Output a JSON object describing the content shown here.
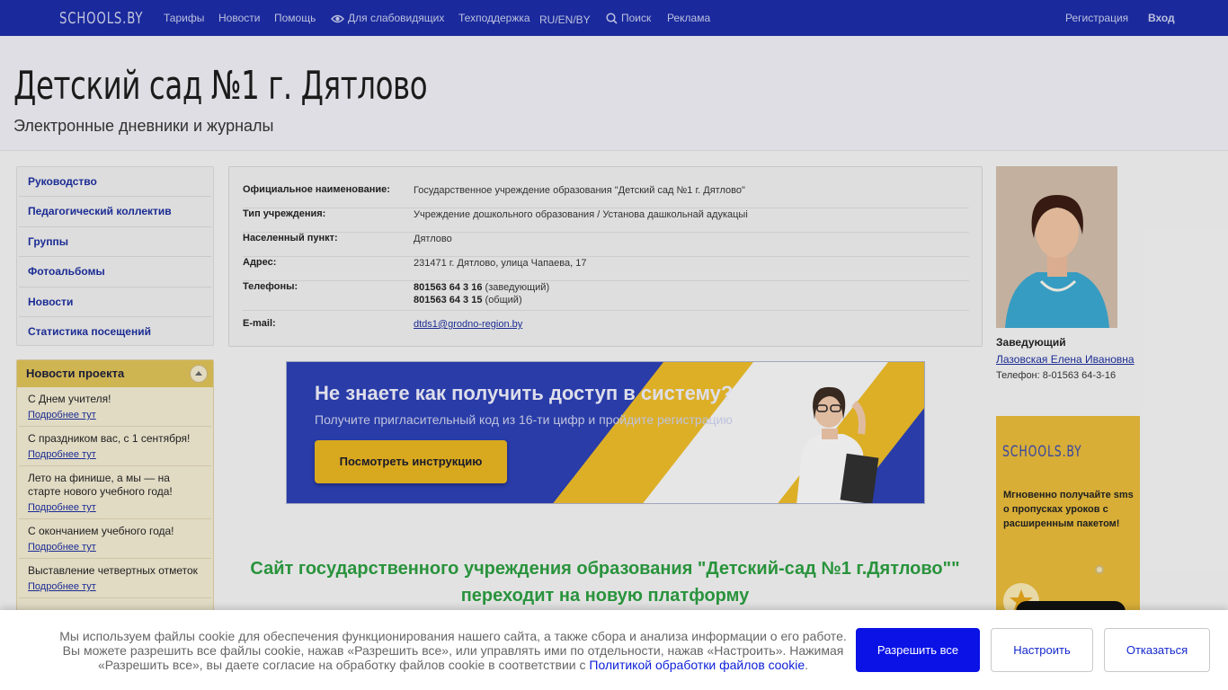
{
  "topbar": {
    "logo": "SCHOOLS.BY",
    "nav": [
      "Тарифы",
      "Новости",
      "Помощь",
      "Для слабовидящих",
      "Техподдержка",
      "RU/EN/BY",
      "Поиск",
      "Реклама"
    ],
    "register": "Регистрация",
    "login": "Вход"
  },
  "header": {
    "title": "Детский сад №1 г. Дятлово",
    "subtitle": "Электронные дневники и журналы"
  },
  "sidebar": {
    "items": [
      "Руководство",
      "Педагогический коллектив",
      "Группы",
      "Фотоальбомы",
      "Новости",
      "Статистика посещений"
    ]
  },
  "project_news": {
    "title": "Новости проекта",
    "more": "Подробнее тут",
    "items": [
      "С Днем учителя!",
      "С праздником вас, с 1 сентября!",
      "Лето на финише, а мы — на старте нового учебного года!",
      "С окончанием учебного года!",
      "Выставление четвертных отметок"
    ]
  },
  "info": {
    "rows": [
      {
        "label": "Официальное наименование:",
        "value": "Государственное учреждение образования \"Детский сад №1 г. Дятлово\""
      },
      {
        "label": "Тип учреждения:",
        "value": "Учреждение дошкольного образования / Установа дашкольнай адукацыі"
      },
      {
        "label": "Населенный пункт:",
        "value": "Дятлово"
      },
      {
        "label": "Адрес:",
        "value": "231471 г. Дятлово, улица Чапаева, 17"
      }
    ],
    "phones_label": "Телефоны:",
    "phone1": "801563 64 3 16",
    "phone1_note": " (заведующий)",
    "phone2": "801563 64 3 15",
    "phone2_note": " (общий)",
    "email_label": "E-mail:",
    "email": "dtds1@grodno-region.by"
  },
  "banner": {
    "headline": "Не знаете как получить доступ в систему?",
    "subline": "Получите пригласительный код из 16-ти цифр и пройдите регистрацию",
    "button": "Посмотреть инструкцию"
  },
  "notice": "Сайт государственного учреждения образования \"Детский-сад №1 г.Дятлово\"\" переходит на новую платформу",
  "director": {
    "role": "Заведующий",
    "name": "Лазовская Елена Ивановна",
    "phone": "Телефон: 8-01563 64-3-16"
  },
  "side_ad": {
    "logo": "SCHOOLS.BY",
    "text": "Мгновенно получайте sms о пропусках уроков с расширенным пакетом!"
  },
  "cookie": {
    "text1": "Мы используем файлы cookie для обеспечения функционирования нашего сайта, а также сбора и анализа информации о его работе.",
    "text2": "Вы можете разрешить все файлы cookie, нажав «Разрешить все», или управлять ими по отдельности, нажав «Настроить». Нажимая",
    "text3": "«Разрешить все», вы даете согласие на обработку файлов cookie в соответствии с ",
    "link": "Политикой обработки файлов cookie",
    "text4": ".",
    "accept": "Разрешить все",
    "settings": "Настроить",
    "decline": "Отказаться"
  },
  "colors": {
    "topbar": "#1c2ba3",
    "link": "#1d2e9a",
    "accent_green": "#2b9a3f",
    "accept_button": "#0a12e6",
    "banner_gold": "#e1af21"
  }
}
